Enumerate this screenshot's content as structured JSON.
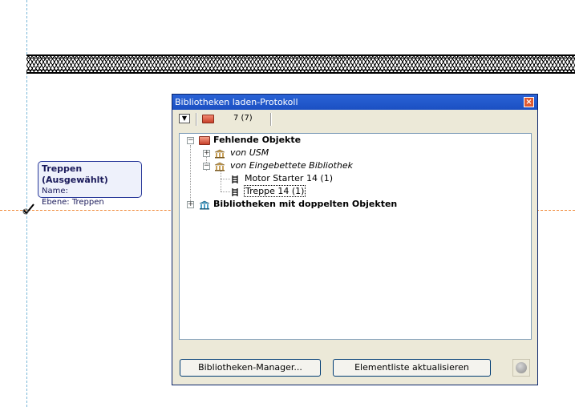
{
  "canvas": {
    "tooltip": {
      "title": "Treppen (Ausgewählt)",
      "name_line": "Name:",
      "layer_line": "Ebene: Treppen"
    }
  },
  "dialog": {
    "title": "Bibliotheken laden-Protokoll",
    "close_glyph": "×",
    "toolbar": {
      "dropdown_glyph": "▼",
      "count": "7 (7)"
    },
    "tree": {
      "missing_objects": "Fehlende Objekte",
      "from_usm": "von USM",
      "from_embedded": "von Eingebettete Bibliothek",
      "item_motor_starter": "Motor Starter 14 (1)",
      "item_treppe": "Treppe 14 (1)",
      "duplicate_libraries": "Bibliotheken mit doppelten Objekten",
      "expand_glyph": "+",
      "collapse_glyph": "−"
    },
    "buttons": {
      "library_manager": "Bibliotheken-Manager...",
      "update_element_list": "Elementliste aktualisieren"
    }
  },
  "icons": {
    "folder": "folder-icon",
    "library": "library-icon",
    "object": "stair-object-icon",
    "status": "status-icon",
    "cursor": "pointer-check-icon"
  }
}
